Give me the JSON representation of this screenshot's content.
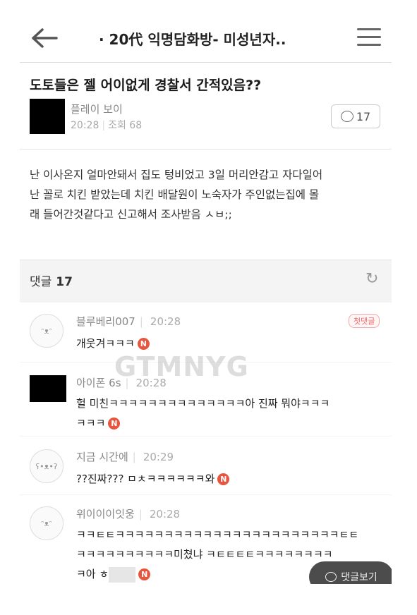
{
  "topbar": {
    "title": "· 20代 익명담화방- 미성년자.."
  },
  "post": {
    "title": "도토들은 젤 어이없게 경찰서 간적있음??",
    "author": "플레이 보이",
    "time": "20:28",
    "views": "조회 68",
    "comment_count": "17",
    "body": [
      "난 이사온지 얼마안돼서 집도 텅비었고 3일 머리안감고 자다일어",
      "난 꼴로 치킨 받았는데 치킨 배달원이 노숙자가 주인없는집에 몰",
      "래 들어간것같다고 신고해서 조사받음 ㅅㅂ;;"
    ]
  },
  "comments_header": {
    "label": "댓글",
    "count": "17"
  },
  "comments": [
    {
      "name": "블루베리007",
      "time": "20:28",
      "badge": "첫댓글",
      "lines": [
        "개웃겨ㅋㅋㅋ"
      ]
    },
    {
      "name": "아이폰 6s",
      "time": "20:28",
      "lines": [
        "헐 미친ㅋㅋㅋㅋㅋㅋㅋㅋㅋㅋㅋㅋㅋㅋ아 진짜 뭐야ㅋㅋㅋ",
        "ㅋㅋㅋ"
      ]
    },
    {
      "name": "지금 시간에",
      "time": "20:29",
      "lines": [
        "??진짜??? ㅁㅊㅋㅋㅋㅋㅋㅋ와"
      ]
    },
    {
      "name": "위이이이잇웅",
      "time": "20:28",
      "lines": [
        "ㅋㅋㅌㅌㅋㅋㅋㅋㅋㅋㅋㅋㅋㅋㅋㅋㅋㅋㅋㅋㅋㅋㅋㅋㅋㅋㅋㅌㅌ",
        "ㅋㅋㅋㅋㅋㅋㅋㅋㅋㅋ미쳤냐 ㅋㅌㅌㅌㅌㅋㅋㅋㅋㅋㅋㅋㅋ",
        "ㅋ아 ㅎ"
      ]
    }
  ],
  "new_badge": "N",
  "watermark": "GTMNYG",
  "float_button": "댓글보기",
  "icons": {
    "back": "back-arrow-icon",
    "menu": "hamburger-menu-icon",
    "refresh": "refresh-icon",
    "comment": "speech-bubble-icon"
  },
  "colors": {
    "new_badge": "#e8553e",
    "first_badge": "#e66666",
    "float_button": "#4c4c4c"
  }
}
